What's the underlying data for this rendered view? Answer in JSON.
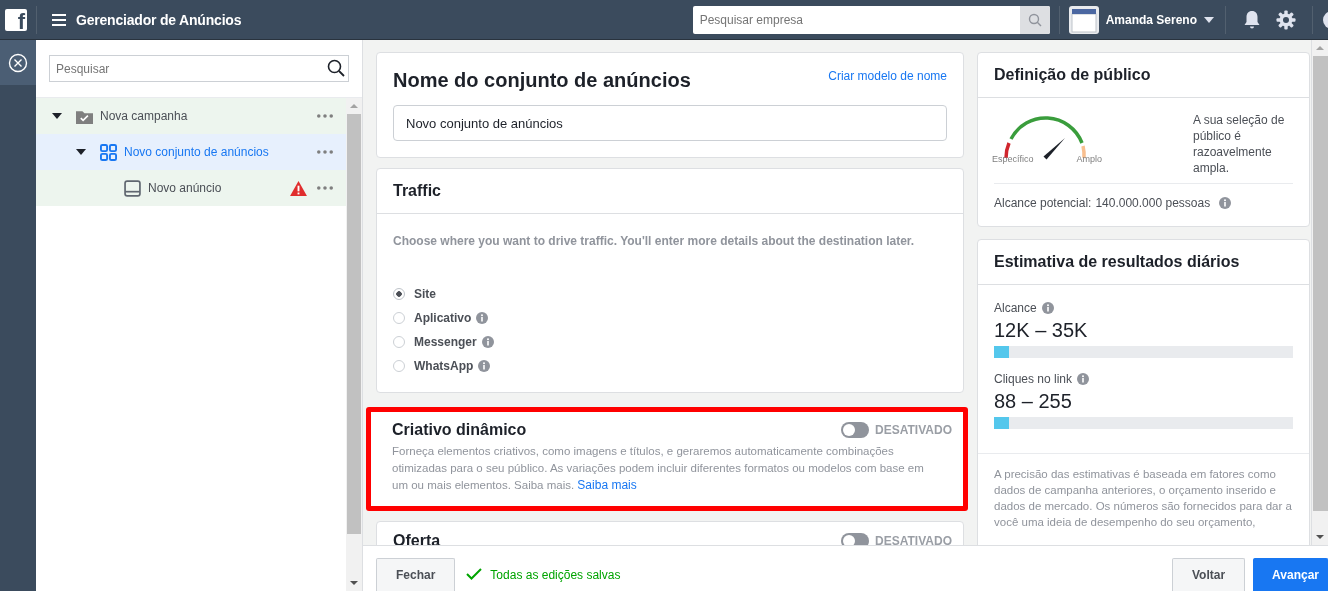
{
  "topbar": {
    "logo": "f",
    "title": "Gerenciador de Anúncios",
    "search": {
      "placeholder": "Pesquisar empresa"
    },
    "account": "Amanda Sereno"
  },
  "tree": {
    "search": {
      "placeholder": "Pesquisar"
    },
    "items": [
      {
        "label": "Nova campanha",
        "kind": "campaign",
        "selected": false,
        "expanded": true,
        "warning": false,
        "children": [
          {
            "label": "Novo conjunto de anúncios",
            "kind": "adset",
            "selected": true,
            "expanded": true,
            "warning": false,
            "children": [
              {
                "label": "Novo anúncio",
                "kind": "ad",
                "selected": false,
                "warning": true
              }
            ]
          }
        ]
      }
    ]
  },
  "name_card": {
    "title": "Nome do conjunto de anúncios",
    "link": "Criar modelo de nome",
    "value": "Novo conjunto de anúncios"
  },
  "traffic": {
    "title": "Traffic",
    "description": "Choose where you want to drive traffic. You'll enter more details about the destination later.",
    "options": [
      {
        "label": "Site",
        "selected": true,
        "info": false
      },
      {
        "label": "Aplicativo",
        "selected": false,
        "info": true
      },
      {
        "label": "Messenger",
        "selected": false,
        "info": true
      },
      {
        "label": "WhatsApp",
        "selected": false,
        "info": true
      }
    ]
  },
  "dynamic_creative": {
    "title": "Criativo dinâmico",
    "on": false,
    "status": "DESATIVADO",
    "highlighted": true,
    "description": "Forneça elementos criativos, como imagens e títulos, e geraremos automaticamente combinações otimizadas para o seu público. As variações podem incluir diferentes formatos ou modelos com base em um ou mais elementos. Saiba mais.",
    "link": "Saiba mais"
  },
  "offer": {
    "title": "Oferta",
    "on": false,
    "status": "DESATIVADO"
  },
  "audience": {
    "title": "Definição de público",
    "min_label": "Específico",
    "max_label": "Amplo",
    "description": "A sua seleção de público é razoavelmente ampla.",
    "reach_label": "Alcance potencial:",
    "reach_value": "140.000.000 pessoas"
  },
  "estimates": {
    "title": "Estimativa de resultados diários",
    "metrics": [
      {
        "label": "Alcance",
        "value": "12K – 35K",
        "level": 0.05
      },
      {
        "label": "Cliques no link",
        "value": "88 – 255",
        "level": 0.05
      }
    ],
    "note": "A precisão das estimativas é baseada em fatores como dados de campanha anteriores, o orçamento inserido e dados de mercado. Os números são fornecidos para dar a você uma ideia de desempenho do seu orçamento,"
  },
  "footer": {
    "close": "Fechar",
    "saved": "Todas as edições salvas",
    "back": "Voltar",
    "next": "Avançar"
  }
}
